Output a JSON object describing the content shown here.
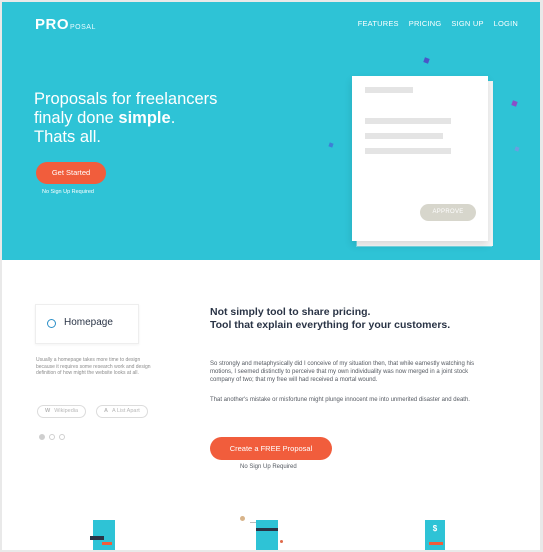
{
  "brand": {
    "pro": "PRO",
    "posal": "POSAL"
  },
  "nav": [
    "FEATURES",
    "PRICING",
    "SIGN UP",
    "LOGIN"
  ],
  "hero": {
    "line1": "Proposals for freelancers",
    "line2_prefix": "finaly done ",
    "line2_bold": "simple",
    "line2_suffix": ".",
    "line3": "Thats all.",
    "button": "Get Started",
    "note": "No Sign Up Required",
    "approve": "APPROVE"
  },
  "feature_card": {
    "label": "Homepage",
    "description": "Usually a homepage takes more time to design because it requires some research work and design definition of how might the website looks at all."
  },
  "tags": [
    {
      "icon": "W",
      "label": "Wikipedia"
    },
    {
      "icon": "A",
      "label": "A List Apart"
    }
  ],
  "section": {
    "title_line1": "Not simply tool to share pricing.",
    "title_line2": "Tool that explain everything for your customers.",
    "paragraph1": "So strongly and metaphysically did I conceive of my situation then, that while earnestly watching his motions, I seemed distinctly to perceive that my own individuality was now merged in a joint stock company of two; that my free will had received a mortal wound.",
    "paragraph2": "That another's mistake or misfortune might plunge innocent me into unmerited disaster and death.",
    "button": "Create a FREE Proposal",
    "note": "No Sign Up Required"
  },
  "icons": {
    "dollar": "$"
  },
  "colors": {
    "teal": "#2ec3d6",
    "accent": "#f15d3c",
    "navy": "#2a3446"
  }
}
